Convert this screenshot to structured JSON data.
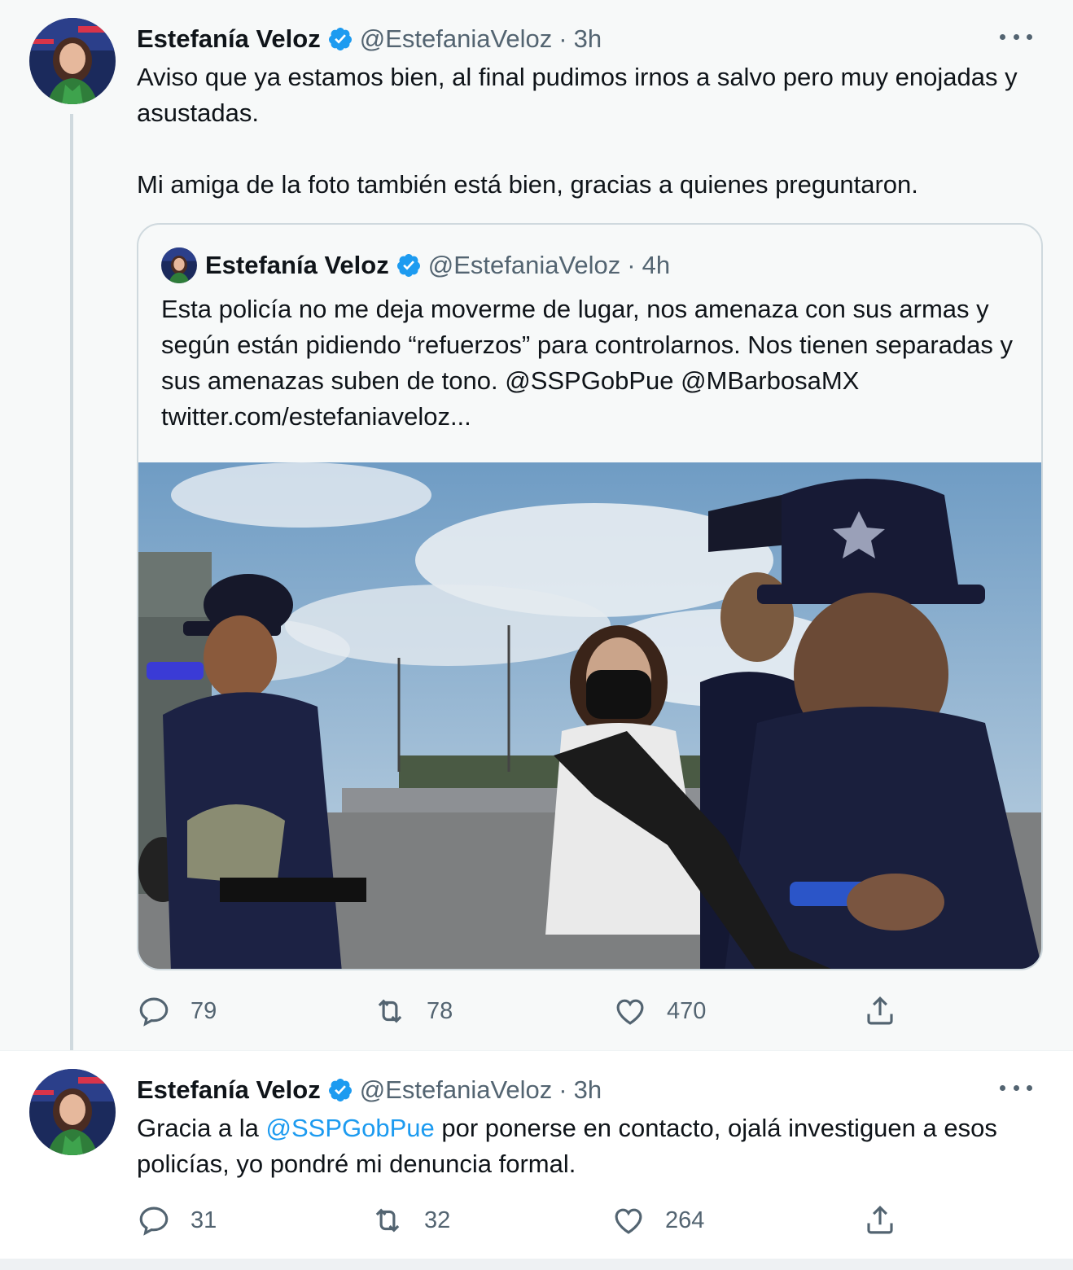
{
  "tweets": [
    {
      "author_name": "Estefanía Veloz",
      "handle": "@EstefaniaVeloz",
      "separator": "·",
      "time": "3h",
      "text": "Aviso que ya estamos bien, al final pudimos irnos a salvo pero muy enojadas y asustadas.\n\nMi amiga de la foto también está bien, gracias a quienes preguntaron.",
      "quote": {
        "author_name": "Estefanía Veloz",
        "handle": "@EstefaniaVeloz",
        "separator": "·",
        "time": "4h",
        "text": "Esta policía no me deja moverme de lugar, nos amenaza con sus armas y según están pidiendo “refuerzos” para controlarnos. Nos tienen separadas y sus amenazas suben de tono. @SSPGobPue @MBarbosaMX  twitter.com/estefaniaveloz..."
      },
      "actions": {
        "replies": "79",
        "retweets": "78",
        "likes": "470"
      }
    },
    {
      "author_name": "Estefanía Veloz",
      "handle": "@EstefaniaVeloz",
      "separator": "·",
      "time": "3h",
      "text_before": "Gracia a la ",
      "mention": "@SSPGobPue",
      "text_after": " por ponerse en contacto, ojalá investiguen a esos policías, yo pondré mi denuncia formal.",
      "actions": {
        "replies": "31",
        "retweets": "32",
        "likes": "264"
      }
    }
  ],
  "colors": {
    "accent": "#1d9bf0",
    "secondary_text": "#536471",
    "border": "#cfd9de"
  },
  "icons": [
    "verified-badge-icon",
    "more-icon",
    "reply-icon",
    "retweet-icon",
    "like-icon",
    "share-icon"
  ]
}
